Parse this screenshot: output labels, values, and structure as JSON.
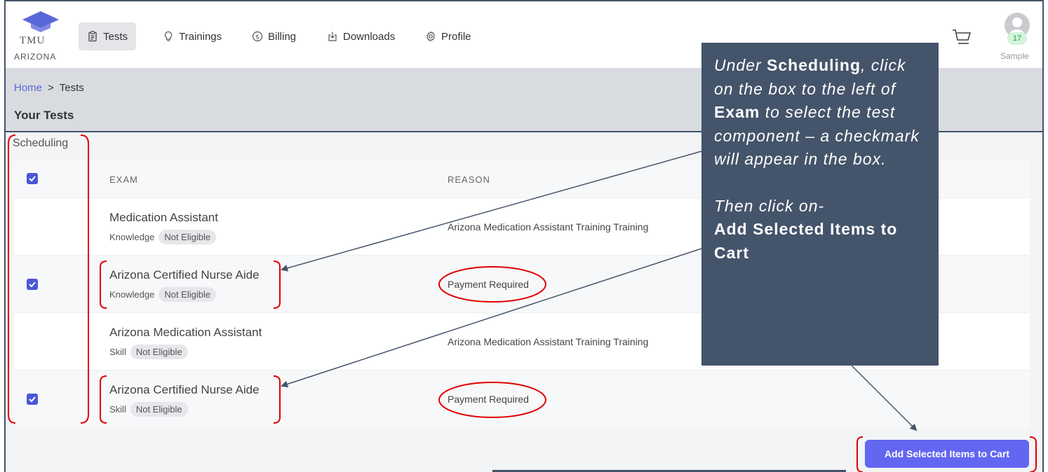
{
  "logo": {
    "abbr": "TMU",
    "state": "ARIZONA"
  },
  "nav": [
    {
      "label": "Tests",
      "icon": "clipboard-icon",
      "active": true
    },
    {
      "label": "Trainings",
      "icon": "lightbulb-icon"
    },
    {
      "label": "Billing",
      "icon": "dollar-circle-icon"
    },
    {
      "label": "Downloads",
      "icon": "download-box-icon"
    },
    {
      "label": "Profile",
      "icon": "gear-icon"
    }
  ],
  "user": {
    "badge": "17",
    "name": "Sample"
  },
  "breadcrumb": {
    "home": "Home",
    "separator": ">",
    "current": "Tests"
  },
  "page_title": "Your Tests",
  "section_label": "Scheduling",
  "table": {
    "headers": {
      "exam": "EXAM",
      "reason": "REASON"
    },
    "header_checked": true,
    "rows": [
      {
        "title": "Medication Assistant",
        "type": "Knowledge",
        "status": "Not Eligible",
        "reason": "Arizona Medication Assistant Training Training",
        "checked": false
      },
      {
        "title": "Arizona Certified Nurse Aide",
        "type": "Knowledge",
        "status": "Not Eligible",
        "reason": "Payment Required",
        "checked": true
      },
      {
        "title": "Arizona Medication Assistant",
        "type": "Skill",
        "status": "Not Eligible",
        "reason": "Arizona Medication Assistant Training Training",
        "checked": false
      },
      {
        "title": "Arizona Certified Nurse Aide",
        "type": "Skill",
        "status": "Not Eligible",
        "reason": "Payment Required",
        "checked": true
      }
    ]
  },
  "add_button": "Add Selected Items to Cart",
  "callout": {
    "p1_a": "Under ",
    "p1_b": "Scheduling",
    "p1_c": ", click on the box to the left of ",
    "p1_d": "Exam",
    "p1_e": " to select the test component – a checkmark will appear in the box.",
    "p2_a": "Then click on-",
    "p2_b": "Add Selected Items to Cart"
  },
  "colors": {
    "accent": "#6366f1",
    "callout": "#44546a",
    "annotation": "#e00000",
    "checkbox": "#4a56d6"
  }
}
